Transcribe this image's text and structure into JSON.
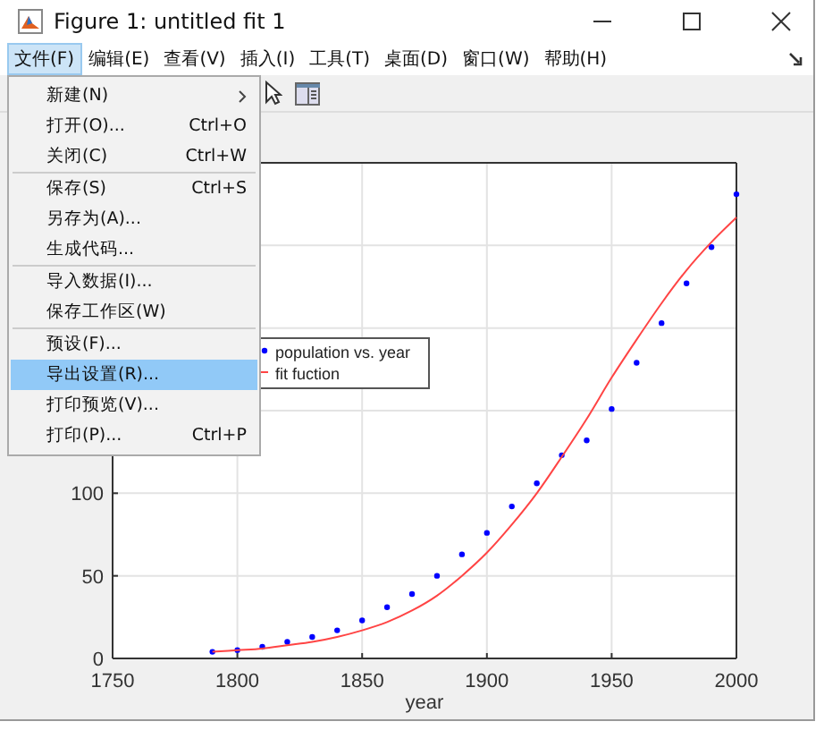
{
  "window": {
    "title": "Figure 1: untitled fit 1"
  },
  "menubar": [
    {
      "label": "文件(F)",
      "selected": true
    },
    {
      "label": "编辑(E)",
      "selected": false
    },
    {
      "label": "查看(V)",
      "selected": false
    },
    {
      "label": "插入(I)",
      "selected": false
    },
    {
      "label": "工具(T)",
      "selected": false
    },
    {
      "label": "桌面(D)",
      "selected": false
    },
    {
      "label": "窗口(W)",
      "selected": false
    },
    {
      "label": "帮助(H)",
      "selected": false
    }
  ],
  "file_menu": [
    {
      "label": "新建(N)",
      "submenu": true,
      "separator_above": false,
      "selected": false
    },
    {
      "label": "打开(O)...",
      "shortcut": "Ctrl+O",
      "submenu": false,
      "separator_above": false,
      "selected": false
    },
    {
      "label": "关闭(C)",
      "shortcut": "Ctrl+W",
      "submenu": false,
      "separator_above": false,
      "selected": false
    },
    {
      "label": "保存(S)",
      "shortcut": "Ctrl+S",
      "submenu": false,
      "separator_above": true,
      "selected": false
    },
    {
      "label": "另存为(A)...",
      "submenu": false,
      "separator_above": false,
      "selected": false
    },
    {
      "label": "生成代码...",
      "submenu": false,
      "separator_above": false,
      "selected": false
    },
    {
      "label": "导入数据(I)...",
      "submenu": false,
      "separator_above": true,
      "selected": false
    },
    {
      "label": "保存工作区(W)",
      "submenu": false,
      "separator_above": false,
      "selected": false
    },
    {
      "label": "预设(F)...",
      "submenu": false,
      "separator_above": true,
      "selected": false
    },
    {
      "label": "导出设置(R)...",
      "submenu": false,
      "separator_above": false,
      "selected": true
    },
    {
      "label": "打印预览(V)...",
      "submenu": false,
      "separator_above": false,
      "selected": false
    },
    {
      "label": "打印(P)...",
      "shortcut": "Ctrl+P",
      "submenu": false,
      "separator_above": false,
      "selected": false
    }
  ],
  "figure": {
    "chart_data": {
      "type": "scatter",
      "xlabel": "year",
      "x": [
        1790,
        1800,
        1810,
        1820,
        1830,
        1840,
        1850,
        1860,
        1870,
        1880,
        1890,
        1900,
        1910,
        1920,
        1930,
        1940,
        1950,
        1960,
        1970,
        1980,
        1990,
        2000
      ],
      "xlim": [
        1750,
        2000
      ],
      "ylim": [
        0,
        300
      ],
      "xticks": [
        1750,
        1800,
        1850,
        1900,
        1950,
        2000
      ],
      "yticks": [
        0,
        50,
        100
      ],
      "grid": true,
      "legend": "upper left",
      "series": [
        {
          "name": "population vs. year",
          "color": "#0000ff",
          "values": [
            4,
            5,
            7,
            10,
            13,
            17,
            23,
            31,
            39,
            50,
            63,
            76,
            92,
            106,
            123,
            132,
            151,
            179,
            203,
            227,
            249,
            281
          ]
        },
        {
          "name": "fit fuction",
          "type": "line",
          "color": "#ff4444",
          "values": [
            4,
            5,
            6,
            8,
            10,
            13,
            17,
            22,
            29,
            38,
            50,
            64,
            81,
            100,
            122,
            145,
            170,
            193,
            215,
            235,
            252,
            267
          ]
        }
      ]
    }
  }
}
